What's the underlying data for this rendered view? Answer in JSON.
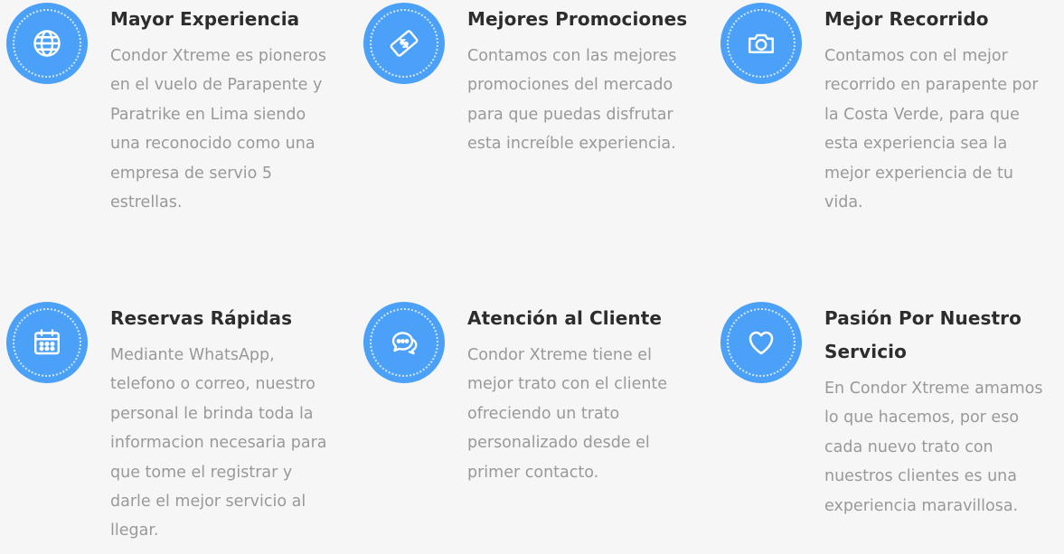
{
  "features": [
    {
      "icon": "globe-icon",
      "title": "Mayor Experiencia",
      "description": "Condor Xtreme es pioneros en el vuelo de Parapente y Paratrike en Lima siendo una reconocido como una empresa de servio 5 estrellas."
    },
    {
      "icon": "money-bill-icon",
      "title": "Mejores Promociones",
      "description": "Contamos con las mejores promociones del mercado para que puedas disfrutar esta increíble experiencia."
    },
    {
      "icon": "camera-icon",
      "title": "Mejor Recorrido",
      "description": "Contamos con el mejor recorrido en parapente por la Costa Verde, para que esta experiencia sea la mejor experiencia de tu vida."
    },
    {
      "icon": "calendar-icon",
      "title": "Reservas Rápidas",
      "description": "Mediante WhatsApp, telefono o correo, nuestro personal le brinda toda la informacion necesaria para que tome el registrar y darle el mejor servicio al llegar."
    },
    {
      "icon": "chat-bubbles-icon",
      "title": "Atención al Cliente",
      "description": "Condor Xtreme tiene el mejor trato con el cliente ofreciendo un trato personalizado desde el primer contacto."
    },
    {
      "icon": "heart-icon",
      "title": "Pasión Por Nuestro Servicio",
      "description": "En Condor Xtreme amamos lo que hacemos, por eso cada nuevo trato con nuestros clientes es una experiencia maravillosa."
    }
  ],
  "colors": {
    "accent": "#4ba0f7",
    "title": "#2d2d2d",
    "text": "#999999",
    "background": "#f6f6f6"
  }
}
